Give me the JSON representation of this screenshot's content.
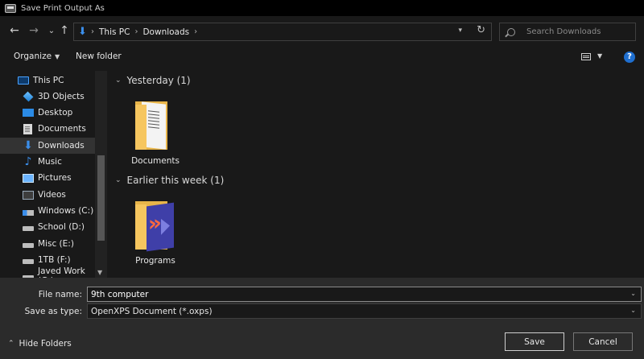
{
  "window": {
    "title": "Save Print Output As"
  },
  "nav": {
    "back": "←",
    "forward": "→",
    "recent": "⌄",
    "up": "↑",
    "breadcrumb": [
      "This PC",
      "Downloads"
    ],
    "search_placeholder": "Search Downloads"
  },
  "toolbar": {
    "organize": "Organize",
    "new_folder": "New folder",
    "help": "?"
  },
  "sidebar": {
    "items": [
      {
        "label": "This PC",
        "icon": "this-pc-icon"
      },
      {
        "label": "3D Objects",
        "icon": "3d-objects-icon"
      },
      {
        "label": "Desktop",
        "icon": "desktop-icon"
      },
      {
        "label": "Documents",
        "icon": "documents-icon"
      },
      {
        "label": "Downloads",
        "icon": "downloads-icon"
      },
      {
        "label": "Music",
        "icon": "music-icon"
      },
      {
        "label": "Pictures",
        "icon": "pictures-icon"
      },
      {
        "label": "Videos",
        "icon": "videos-icon"
      },
      {
        "label": "Windows (C:)",
        "icon": "windows-drive-icon"
      },
      {
        "label": "School (D:)",
        "icon": "drive-icon"
      },
      {
        "label": "Misc (E:)",
        "icon": "drive-icon"
      },
      {
        "label": "1TB (F:)",
        "icon": "drive-icon"
      },
      {
        "label": "Javed Work (G:)",
        "icon": "drive-icon"
      }
    ]
  },
  "content": {
    "groups": [
      {
        "header": "Yesterday (1)",
        "items": [
          {
            "label": "Documents",
            "icon": "documents-folder-icon"
          }
        ]
      },
      {
        "header": "Earlier this week (1)",
        "items": [
          {
            "label": "Programs",
            "icon": "programs-folder-icon"
          }
        ]
      }
    ]
  },
  "form": {
    "file_name_label": "File name:",
    "file_name_value": "9th computer",
    "save_type_label": "Save as type:",
    "save_type_value": "OpenXPS Document (*.oxps)"
  },
  "footer": {
    "hide_folders": "Hide Folders",
    "save": "Save",
    "cancel": "Cancel"
  },
  "colors": {
    "accent": "#3b8eea",
    "background": "#191919",
    "panel": "#2b2b2b"
  }
}
